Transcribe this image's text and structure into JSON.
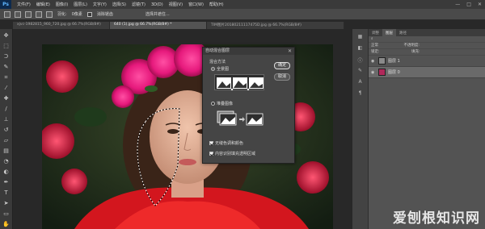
{
  "menubar": {
    "logo": "Ps",
    "items": [
      "文件(F)",
      "编辑(E)",
      "图像(I)",
      "图层(L)",
      "文字(Y)",
      "选择(S)",
      "滤镜(T)",
      "3D(D)",
      "视图(V)",
      "窗口(W)",
      "帮助(H)"
    ],
    "controls": [
      "—",
      "□",
      "✕"
    ]
  },
  "options": {
    "feather_label": "羽化:",
    "feather_value": "0像素",
    "antialias_label": "消除锯齿",
    "refine_label": "选择并遮住..."
  },
  "tabs": [
    {
      "label": "xjvc-1982815_960_720.jpg @ 66.7%(RGB/8#)",
      "active": false
    },
    {
      "label": "640 (1).jpg @ 66.7%(RGB/8#) *",
      "active": true
    },
    {
      "label": "TIM图片20180211117475D.jpg @ 66.7%(RGB/8#)",
      "active": false
    }
  ],
  "dialog": {
    "title": "自动混合图层",
    "close": "✕",
    "blend_method_label": "混合方法",
    "option_panorama": "全景图",
    "option_stack": "堆叠图像",
    "ok": "确定",
    "cancel": "取消",
    "check_seamless": "无缝色调和颜色",
    "check_fill": "内容识别填充透明区域"
  },
  "panel": {
    "tabs": [
      "调整",
      "图层",
      "路径"
    ],
    "mode": "正常",
    "opacity_label": "不透明度:",
    "lock_label": "锁定:",
    "fill_label": "填充:",
    "layers": [
      {
        "name": "图层 1",
        "selected": false
      },
      {
        "name": "图层 0",
        "selected": true
      }
    ]
  },
  "watermark": "爱刨根知识网"
}
